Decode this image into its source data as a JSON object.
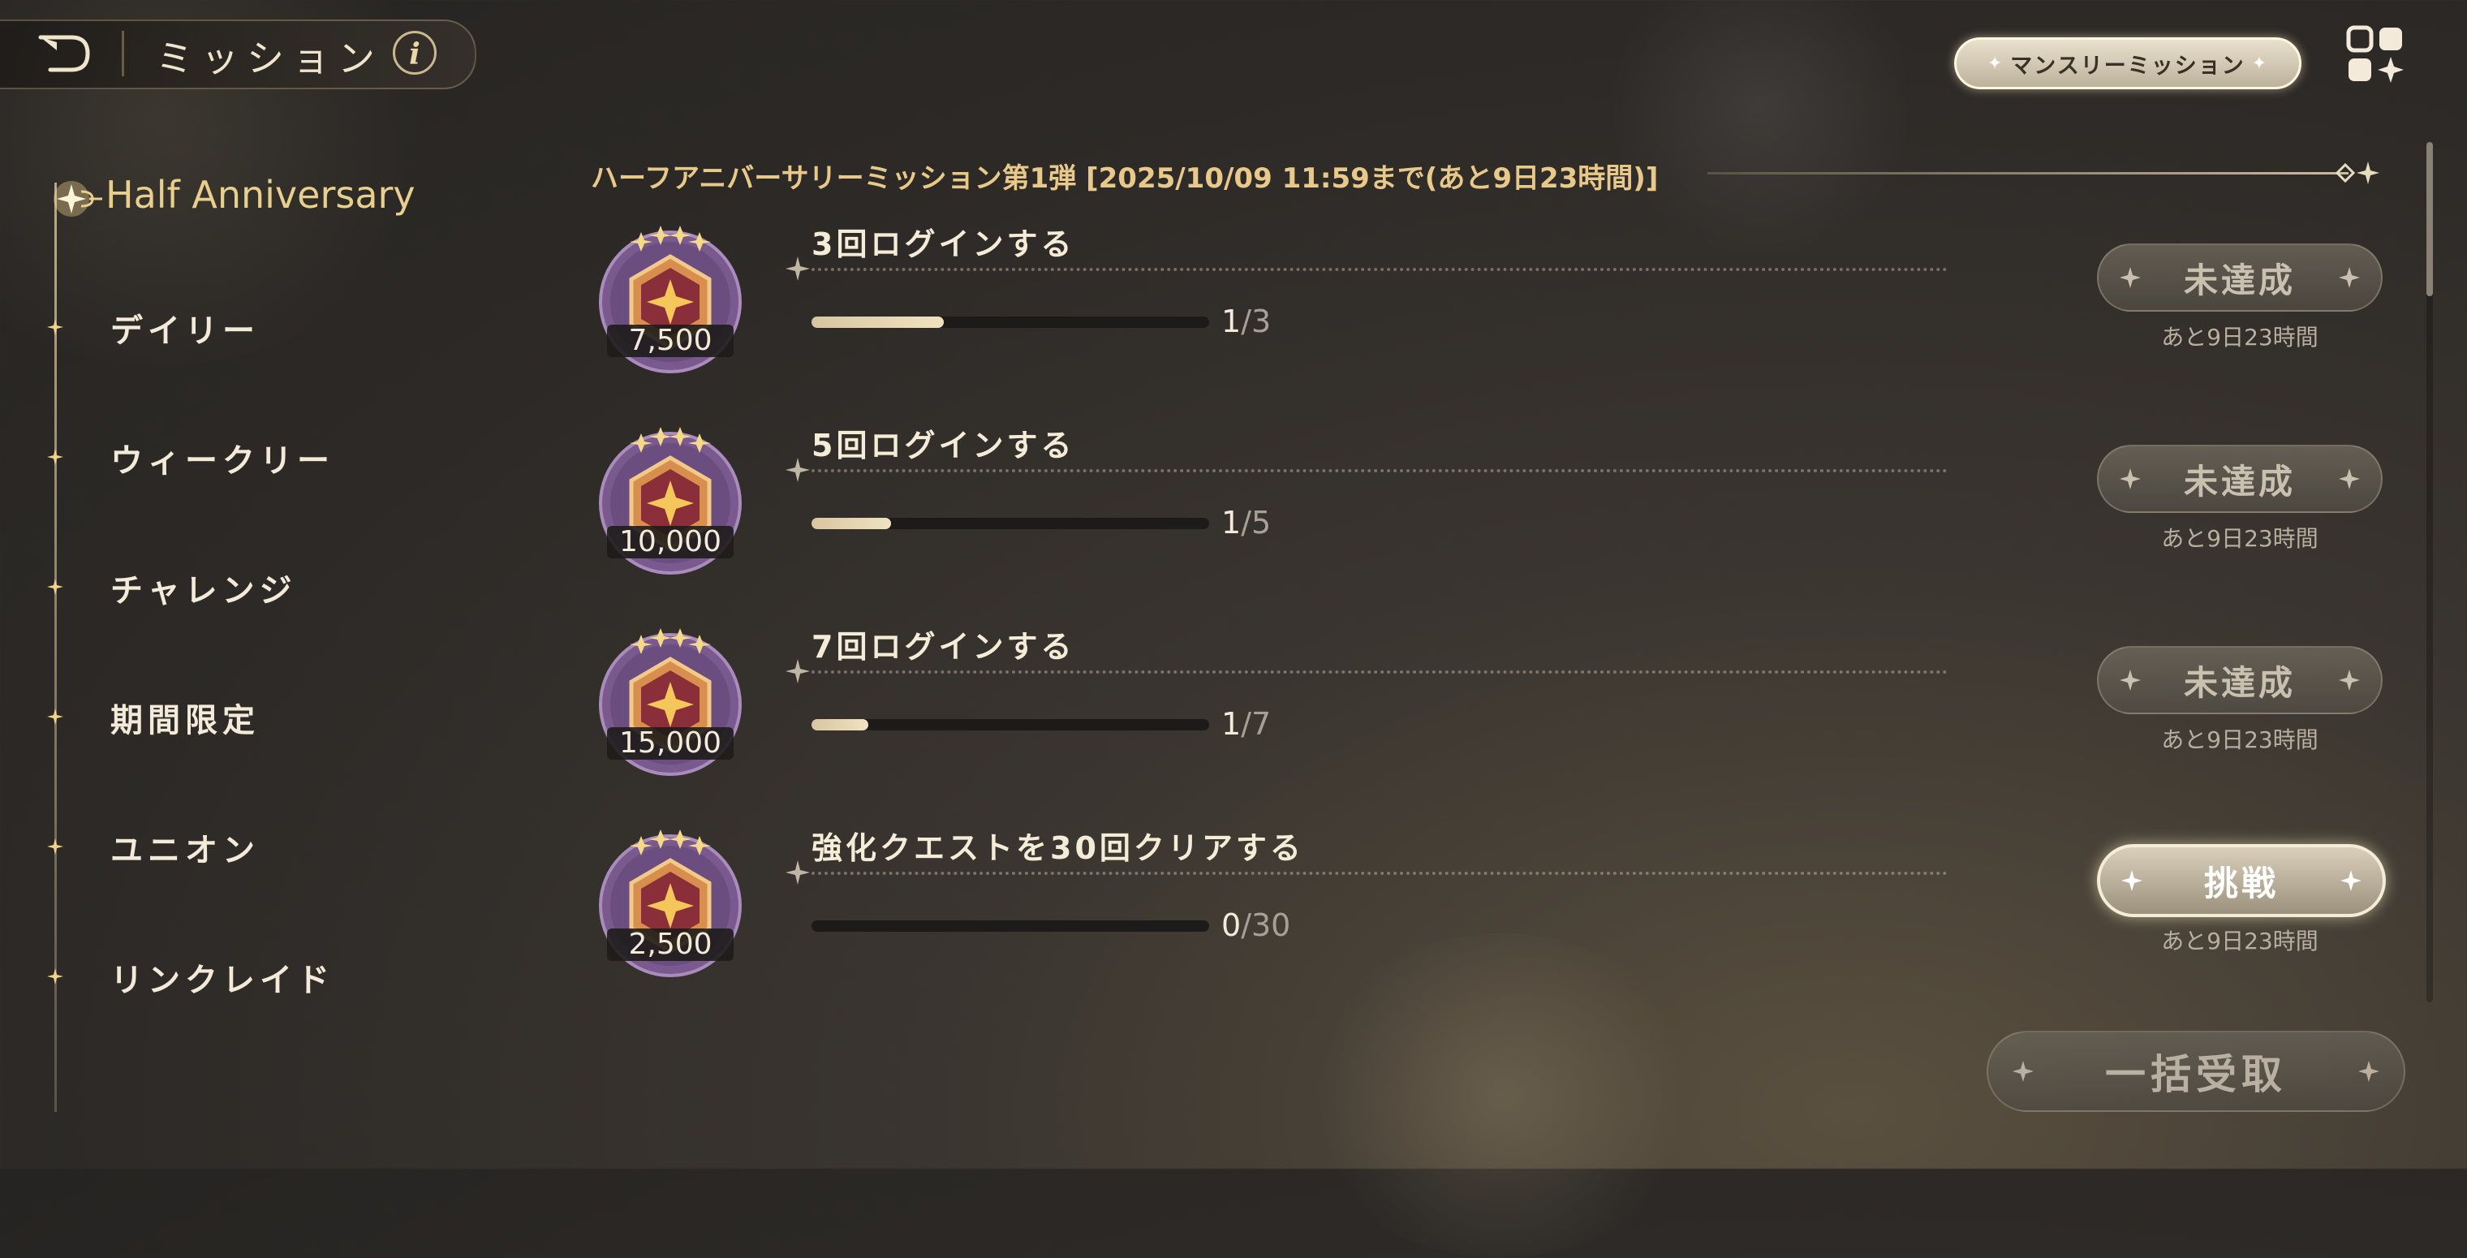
{
  "header": {
    "title": "ミッション",
    "info_label": "i",
    "monthly_button": "マンスリーミッション"
  },
  "sidebar": {
    "active_label": "Half Anniversary",
    "items": [
      {
        "label": "デイリー"
      },
      {
        "label": "ウィークリー"
      },
      {
        "label": "チャレンジ"
      },
      {
        "label": "期間限定"
      },
      {
        "label": "ユニオン"
      },
      {
        "label": "リンクレイド"
      }
    ]
  },
  "section": {
    "title": "ハーフアニバーサリーミッション第1弾 [2025/10/09 11:59まで(あと9日23時間)]"
  },
  "missions": [
    {
      "title": "3回ログインする",
      "reward": "7,500",
      "current": "1",
      "total": "/3",
      "fraction": 0.333,
      "status": "未達成",
      "remaining": "あと9日23時間"
    },
    {
      "title": "5回ログインする",
      "reward": "10,000",
      "current": "1",
      "total": "/5",
      "fraction": 0.2,
      "status": "未達成",
      "remaining": "あと9日23時間"
    },
    {
      "title": "7回ログインする",
      "reward": "15,000",
      "current": "1",
      "total": "/7",
      "fraction": 0.143,
      "status": "未達成",
      "remaining": "あと9日23時間"
    },
    {
      "title": "強化クエストを30回クリアする",
      "reward": "2,500",
      "current": "0",
      "total": "/30",
      "fraction": 0.0,
      "status": "挑戦",
      "remaining": "あと9日23時間"
    }
  ],
  "bulk_button": "一括受取",
  "colors": {
    "accent_gold": "#e8c98a",
    "reward_purple": "#7a5a8e",
    "background": "#2c2926"
  }
}
